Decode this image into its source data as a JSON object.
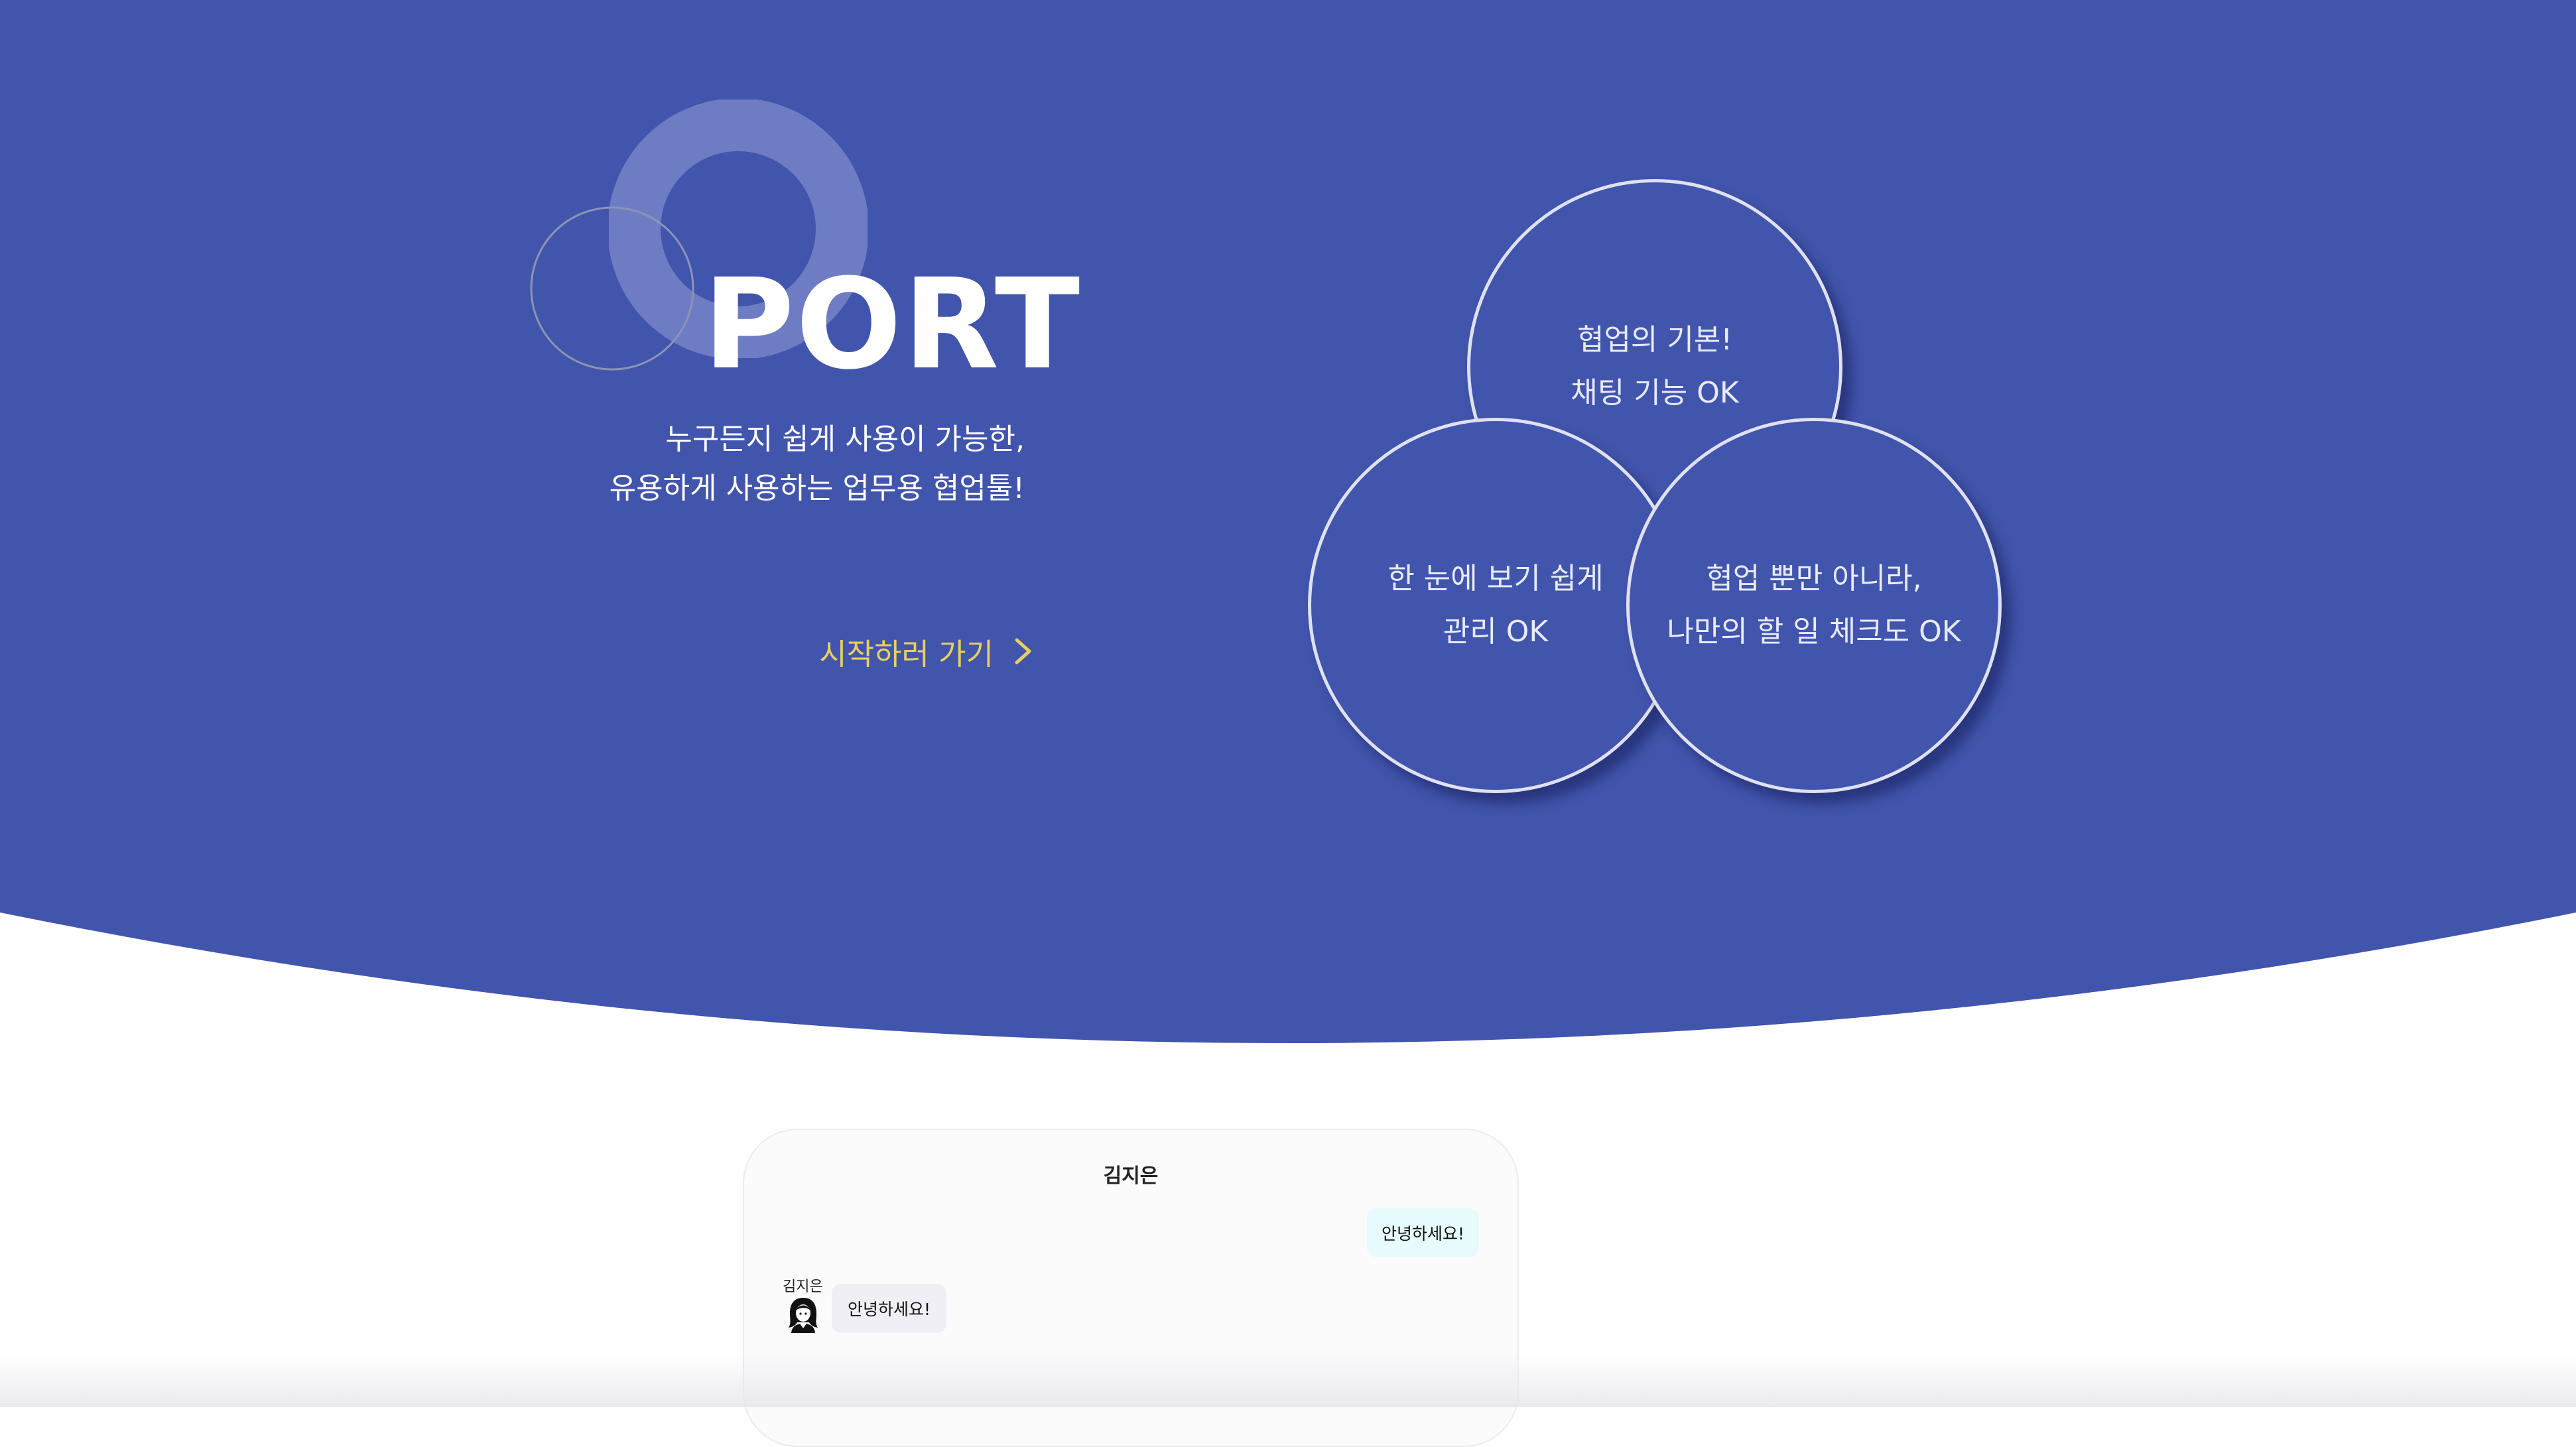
{
  "colors": {
    "hero_background": "#4255ac",
    "accent_link": "#e9cf5f",
    "text_light": "#ffffff",
    "sent_bubble": "#e8fbfc",
    "received_bubble": "#efeff5"
  },
  "hero": {
    "logo_text": "PORT",
    "tagline_line1": "누구든지 쉽게 사용이 가능한,",
    "tagline_line2": "유용하게 사용하는 업무용 협업툴!",
    "start_label": "시작하러 가기",
    "start_icon": "chevron-right-icon"
  },
  "features": [
    {
      "line1": "협업의 기본!",
      "line2": "채팅 기능 OK"
    },
    {
      "line1": "한 눈에 보기 쉽게",
      "line2": "관리 OK"
    },
    {
      "line1": "협업 뿐만 아니라,",
      "line2": "나만의 할 일 체크도 OK"
    }
  ],
  "chat_preview": {
    "title": "김지은",
    "sent_message": "안녕하세요!",
    "sender_name": "김지은",
    "received_message": "안녕하세요!",
    "avatar_icon": "user-avatar-icon"
  }
}
